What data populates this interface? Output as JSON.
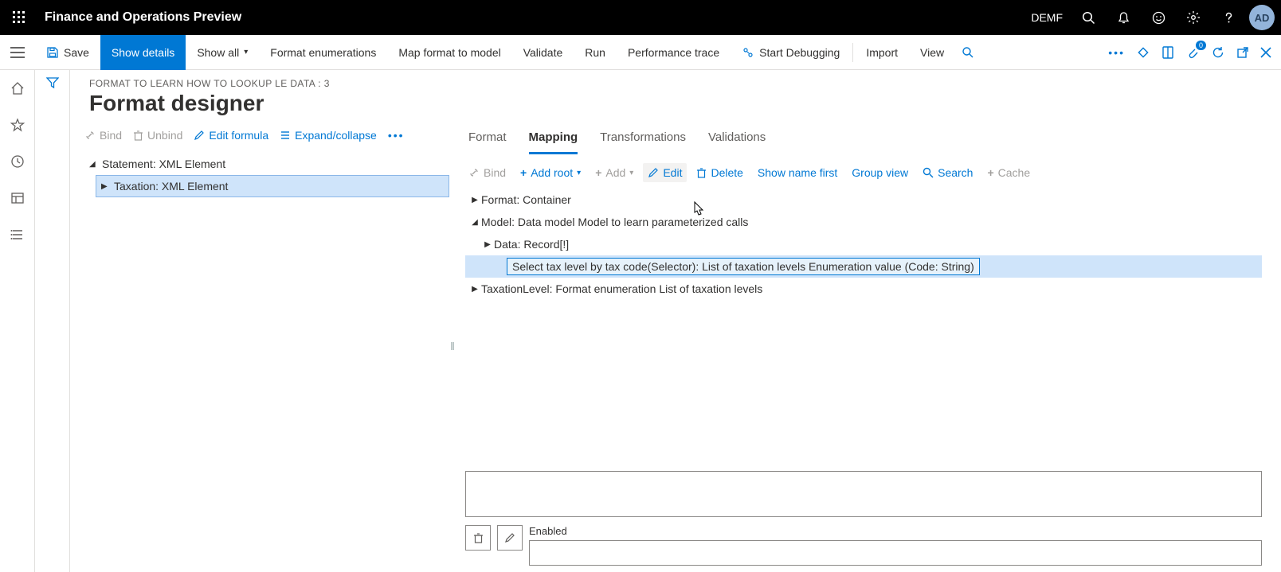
{
  "topbar": {
    "title": "Finance and Operations Preview",
    "company": "DEMF",
    "avatar": "AD"
  },
  "actionbar": {
    "save": "Save",
    "show_details": "Show details",
    "show_all": "Show all",
    "format_enums": "Format enumerations",
    "map_format": "Map format to model",
    "validate": "Validate",
    "run": "Run",
    "perf_trace": "Performance trace",
    "start_debug": "Start Debugging",
    "import": "Import",
    "view": "View",
    "badge_count": "0"
  },
  "page": {
    "breadcrumb": "FORMAT TO LEARN HOW TO LOOKUP LE DATA : 3",
    "title": "Format designer"
  },
  "left_toolbar": {
    "bind": "Bind",
    "unbind": "Unbind",
    "edit_formula": "Edit formula",
    "expand": "Expand/collapse"
  },
  "left_tree": {
    "root": "Statement: XML Element",
    "child": "Taxation: XML Element"
  },
  "tabs": {
    "format": "Format",
    "mapping": "Mapping",
    "transformations": "Transformations",
    "validations": "Validations"
  },
  "right_toolbar": {
    "bind": "Bind",
    "add_root": "Add root",
    "add": "Add",
    "edit": "Edit",
    "delete": "Delete",
    "show_name_first": "Show name first",
    "group_view": "Group view",
    "search": "Search",
    "cache": "Cache"
  },
  "right_tree": {
    "format": "Format: Container",
    "model": "Model: Data model Model to learn parameterized calls",
    "data": "Data: Record[!]",
    "selector": "Select tax level by tax code(Selector): List of taxation levels Enumeration value (Code: String)",
    "taxlevel": "TaxationLevel: Format enumeration List of taxation levels"
  },
  "lower": {
    "enabled_label": "Enabled"
  }
}
